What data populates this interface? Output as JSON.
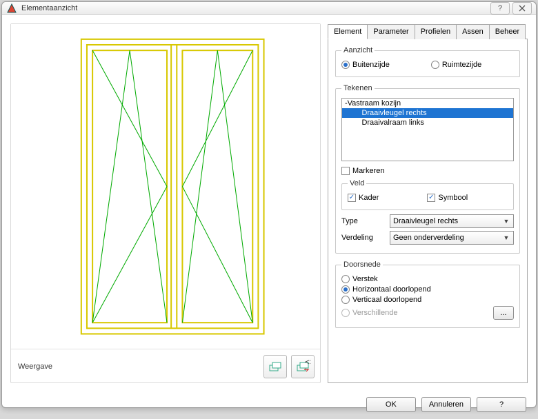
{
  "window": {
    "title": "Elementaanzicht"
  },
  "tabs": [
    "Element",
    "Parameter",
    "Profielen",
    "Assen",
    "Beheer"
  ],
  "aanzicht": {
    "legend": "Aanzicht",
    "options": {
      "buiten": "Buitenzijde",
      "ruimte": "Ruimtezijde"
    },
    "selected": "buiten"
  },
  "tekenen": {
    "legend": "Tekenen",
    "items": [
      "-Vastraam kozijn",
      "        Draaivleugel rechts",
      "        Draaivalraam links"
    ],
    "selected_index": 1,
    "markeren_label": "Markeren",
    "markeren_checked": false,
    "veld": {
      "legend": "Veld",
      "kader_label": "Kader",
      "kader_checked": true,
      "symbool_label": "Symbool",
      "symbool_checked": true
    },
    "type_label": "Type",
    "type_value": "Draaivleugel rechts",
    "verdeling_label": "Verdeling",
    "verdeling_value": "Geen onderverdeling"
  },
  "doorsnede": {
    "legend": "Doorsnede",
    "options": {
      "verstek": "Verstek",
      "horizontaal": "Horizontaal doorlopend",
      "verticaal": "Verticaal doorlopend",
      "verschillende": "Verschillende"
    },
    "selected": "horizontaal",
    "more_btn": "..."
  },
  "weergave": {
    "label": "Weergave"
  },
  "buttons": {
    "ok": "OK",
    "cancel": "Annuleren",
    "help": "?"
  }
}
